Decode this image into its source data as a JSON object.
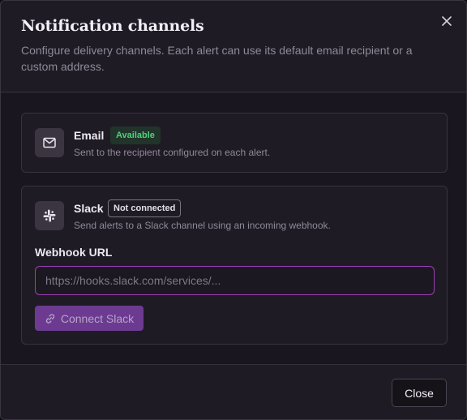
{
  "dialog": {
    "title": "Notification channels",
    "subtitle": "Configure delivery channels. Each alert can use its default email recipient or a custom address."
  },
  "channels": {
    "email": {
      "icon": "mail-icon",
      "name": "Email",
      "badge": "Available",
      "description": "Sent to the recipient configured on each alert."
    },
    "slack": {
      "icon": "slack-icon",
      "name": "Slack",
      "badge": "Not connected",
      "description": "Send alerts to a Slack channel using an incoming webhook.",
      "webhook_label": "Webhook URL",
      "webhook_placeholder": "https://hooks.slack.com/services/...",
      "webhook_value": "",
      "connect_label": "Connect Slack",
      "connect_icon": "link-icon"
    }
  },
  "footer": {
    "close_label": "Close"
  },
  "colors": {
    "accent": "#9b3fb4",
    "button_primary": "#6c3b91",
    "badge_available": "#4fd07d",
    "background": "#1f1b24"
  }
}
